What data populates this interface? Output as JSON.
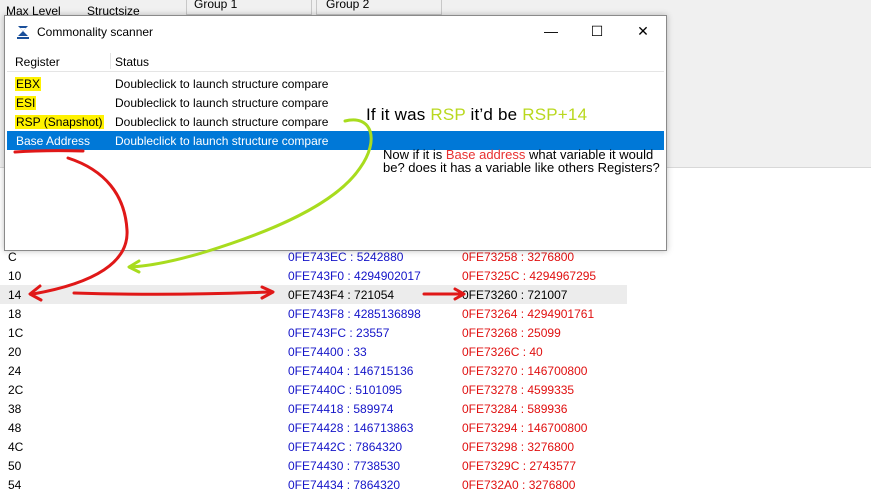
{
  "background": {
    "labels": [
      "Max Level",
      "Structsize"
    ],
    "groups": [
      "Group 1",
      "Group 2"
    ]
  },
  "dialog": {
    "title": "Commonality scanner",
    "controls": {
      "minimize": "—",
      "maximize": "☐",
      "close": "✕"
    },
    "columns": [
      "Register",
      "Status"
    ],
    "rows": [
      {
        "register": "EBX",
        "status": "Doubleclick to launch structure compare"
      },
      {
        "register": "ESI",
        "status": "Doubleclick to launch structure compare"
      },
      {
        "register": "RSP (Snapshot)",
        "status": "Doubleclick to launch structure compare"
      },
      {
        "register": "Base Address",
        "status": "Doubleclick to launch structure compare"
      }
    ]
  },
  "annotations": {
    "rsp_note": {
      "p1": "If it was ",
      "p2": "RSP",
      "p3": " it’d be ",
      "p4": "RSP+14"
    },
    "base_note": {
      "p1": "Now if it is ",
      "p2": "Base address",
      "p3": " what variable it would be? does it has a variable like others Registers?"
    }
  },
  "structure_rows": [
    {
      "offset": "C",
      "g1": "0FE743EC : 5242880",
      "g2": "0FE73258 : 3276800"
    },
    {
      "offset": "10",
      "g1": "0FE743F0 : 4294902017",
      "g2": "0FE7325C : 4294967295"
    },
    {
      "offset": "14",
      "g1": "0FE743F4 : 721054",
      "g2": "0FE73260 : 721007"
    },
    {
      "offset": "18",
      "g1": "0FE743F8 : 4285136898",
      "g2": "0FE73264 : 4294901761"
    },
    {
      "offset": "1C",
      "g1": "0FE743FC : 23557",
      "g2": "0FE73268 : 25099"
    },
    {
      "offset": "20",
      "g1": "0FE74400 : 33",
      "g2": "0FE7326C : 40"
    },
    {
      "offset": "24",
      "g1": "0FE74404 : 146715136",
      "g2": "0FE73270 : 146700800"
    },
    {
      "offset": "2C",
      "g1": "0FE7440C : 5101095",
      "g2": "0FE73278 : 4599335"
    },
    {
      "offset": "38",
      "g1": "0FE74418 : 589974",
      "g2": "0FE73284 : 589936"
    },
    {
      "offset": "48",
      "g1": "0FE74428 : 146713863",
      "g2": "0FE73294 : 146700800"
    },
    {
      "offset": "4C",
      "g1": "0FE7442C : 7864320",
      "g2": "0FE73298 : 3276800"
    },
    {
      "offset": "50",
      "g1": "0FE74430 : 7738530",
      "g2": "0FE7329C : 2743577"
    },
    {
      "offset": "54",
      "g1": "0FE74434 : 7864320",
      "g2": "0FE732A0 : 3276800"
    }
  ],
  "colors": {
    "selection": "#0078d7",
    "highlight": "#fff200",
    "annotation_lime": "#b9d81e",
    "annotation_red": "#e83030"
  },
  "icons": [
    "cheat-engine-icon",
    "minimize-icon",
    "maximize-icon",
    "close-icon"
  ]
}
